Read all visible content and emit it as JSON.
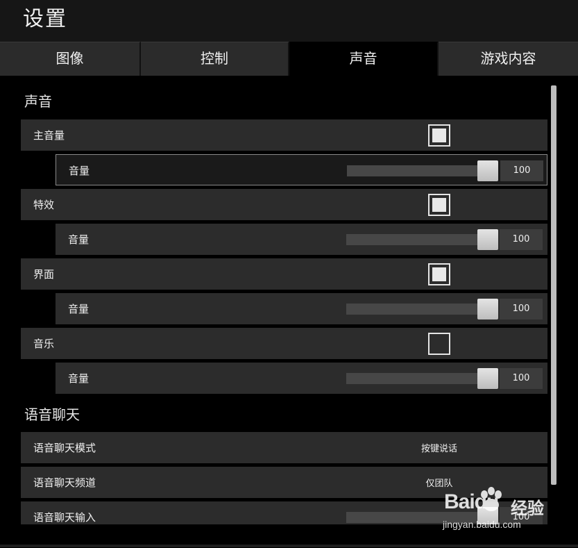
{
  "window": {
    "title": "设置"
  },
  "tabs": [
    {
      "label": "图像",
      "active": false
    },
    {
      "label": "控制",
      "active": false
    },
    {
      "label": "声音",
      "active": true
    },
    {
      "label": "游戏内容",
      "active": false
    }
  ],
  "sound_section": {
    "title": "声音",
    "items": [
      {
        "label": "主音量",
        "enabled": true,
        "volume_label": "音量",
        "volume": 100
      },
      {
        "label": "特效",
        "enabled": true,
        "volume_label": "音量",
        "volume": 100
      },
      {
        "label": "界面",
        "enabled": true,
        "volume_label": "音量",
        "volume": 100
      },
      {
        "label": "音乐",
        "enabled": false,
        "volume_label": "音量",
        "volume": 100
      }
    ]
  },
  "voice_section": {
    "title": "语音聊天",
    "mode": {
      "label": "语音聊天模式",
      "value": "按键说话"
    },
    "channel": {
      "label": "语音聊天频道",
      "value": "仅团队"
    },
    "input": {
      "label": "语音聊天输入",
      "volume": 100
    }
  },
  "watermark": {
    "brand": "Baidu",
    "cn": "经验",
    "url": "jingyan.baidu.com"
  }
}
